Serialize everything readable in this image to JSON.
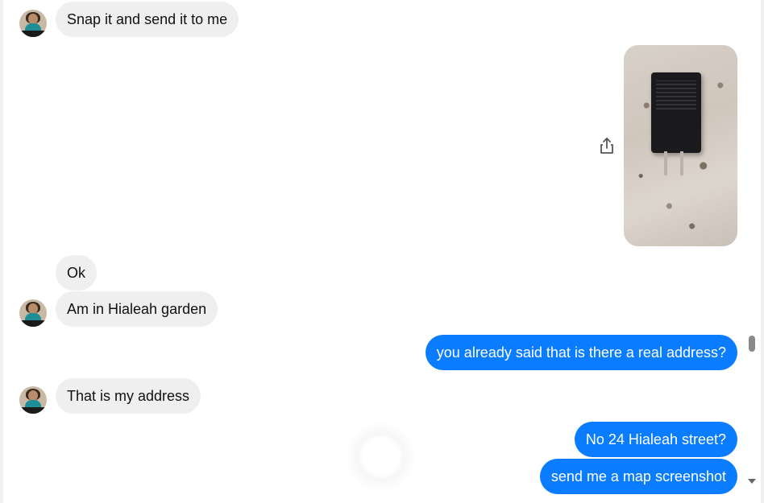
{
  "conversation": {
    "messages": [
      {
        "direction": "incoming",
        "text": "Snap it and send it to me",
        "show_avatar": true
      },
      {
        "direction": "outgoing",
        "type": "image",
        "image_alt": "black phone charger on granite countertop"
      },
      {
        "direction": "incoming",
        "text": "Ok",
        "show_avatar": false
      },
      {
        "direction": "incoming",
        "text": "Am in Hialeah garden",
        "show_avatar": true
      },
      {
        "direction": "outgoing",
        "text": "you already said that is there a real address?"
      },
      {
        "direction": "incoming",
        "text": "That is my address",
        "show_avatar": true
      },
      {
        "direction": "outgoing",
        "text": "No 24  Hialeah street?"
      },
      {
        "direction": "outgoing",
        "text": "send me a map screenshot"
      }
    ]
  },
  "icons": {
    "share": "share-icon",
    "scroll_down": "chevron-down-icon"
  },
  "colors": {
    "outgoing_bubble": "#0a7cff",
    "incoming_bubble": "#efefef",
    "incoming_text": "#111111",
    "outgoing_text": "#ffffff"
  }
}
